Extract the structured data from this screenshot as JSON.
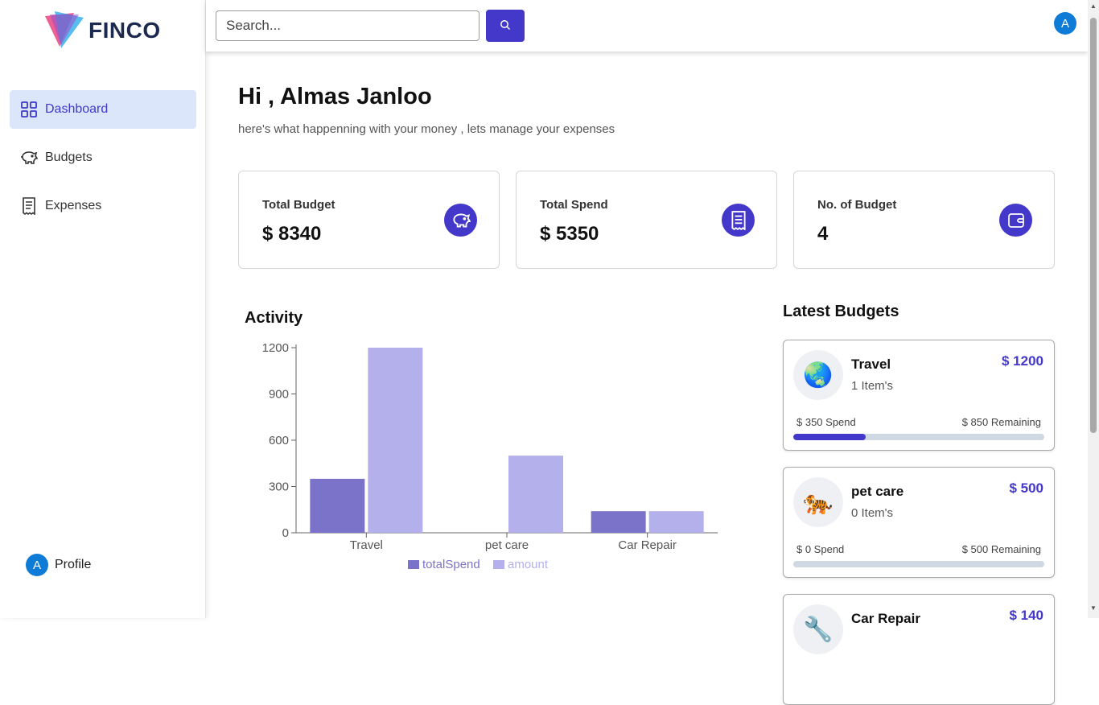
{
  "app": {
    "logo_text": "FINCO"
  },
  "sidebar": {
    "items": [
      {
        "label": "Dashboard",
        "icon": "grid-icon",
        "active": true
      },
      {
        "label": "Budgets",
        "icon": "piggy-bank-icon",
        "active": false
      },
      {
        "label": "Expenses",
        "icon": "receipt-icon",
        "active": false
      }
    ],
    "profile_label": "Profile",
    "avatar_initial": "A"
  },
  "header": {
    "search_placeholder": "Search...",
    "avatar_initial": "A"
  },
  "main": {
    "greeting": "Hi , Almas Janloo",
    "subtitle": "here's what happenning with your money , lets manage your expenses",
    "cards": [
      {
        "label": "Total Budget",
        "value": "$ 8340",
        "icon": "piggy-bank-icon"
      },
      {
        "label": "Total Spend",
        "value": "$ 5350",
        "icon": "receipt-icon"
      },
      {
        "label": "No. of Budget",
        "value": "4",
        "icon": "wallet-icon"
      }
    ],
    "activity_title": "Activity",
    "latest_title": "Latest Budgets",
    "budgets": [
      {
        "emoji": "🌏",
        "name": "Travel",
        "items": "1 Item's",
        "amount": "$ 1200",
        "spend": "$ 350 Spend",
        "remaining": "$ 850 Remaining",
        "progress": 0.29
      },
      {
        "emoji": "🐅",
        "name": "pet care",
        "items": "0 Item's",
        "amount": "$ 500",
        "spend": "$ 0 Spend",
        "remaining": "$ 500 Remaining",
        "progress": 0
      },
      {
        "emoji": "🔧",
        "name": "Car Repair",
        "items": "",
        "amount": "$ 140",
        "spend": "",
        "remaining": "",
        "progress": 0
      }
    ]
  },
  "colors": {
    "accent": "#4338ca",
    "spend_bar": "#7b73c9",
    "amount_bar": "#b3b0eb"
  },
  "chart_data": {
    "type": "bar",
    "categories": [
      "Travel",
      "pet care",
      "Car Repair"
    ],
    "series": [
      {
        "name": "totalSpend",
        "values": [
          350,
          0,
          140
        ]
      },
      {
        "name": "amount",
        "values": [
          1200,
          500,
          140
        ]
      }
    ],
    "yticks": [
      0,
      300,
      600,
      900,
      1200
    ],
    "ylim": [
      0,
      1200
    ],
    "legend": "bottom"
  }
}
